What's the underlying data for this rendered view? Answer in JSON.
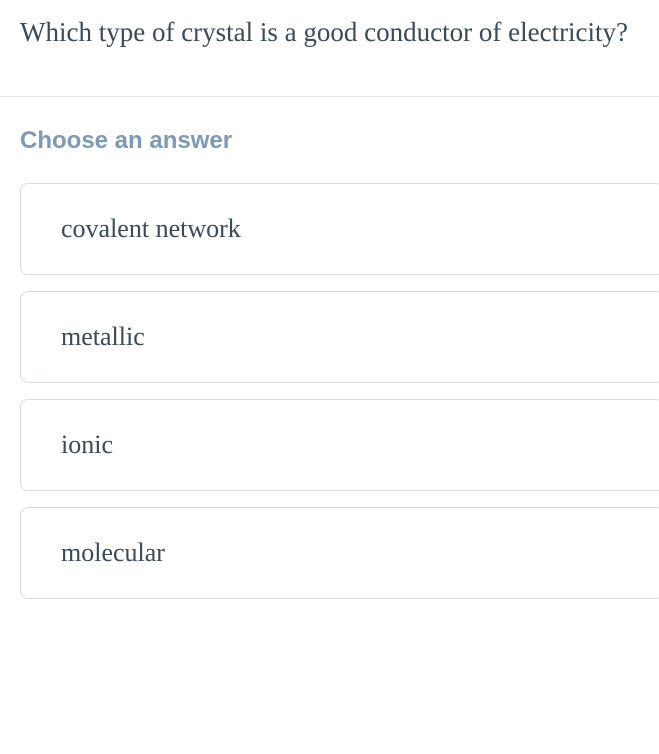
{
  "question": {
    "text": "Which type of crystal is a good conductor of electricity?"
  },
  "answer_prompt": "Choose an answer",
  "options": [
    {
      "label": "covalent network"
    },
    {
      "label": "metallic"
    },
    {
      "label": "ionic"
    },
    {
      "label": "molecular"
    }
  ]
}
